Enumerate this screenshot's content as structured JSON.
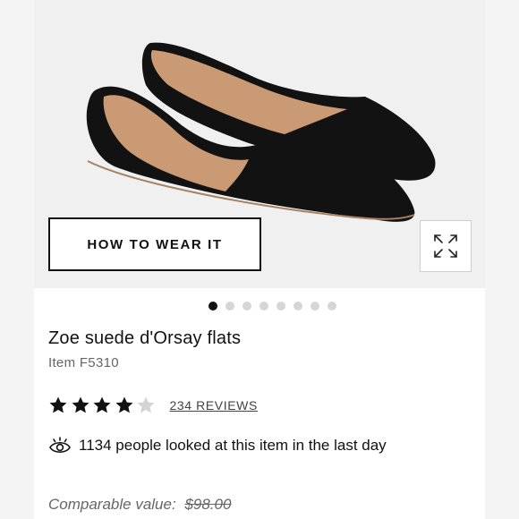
{
  "product": {
    "how_to_wear_label": "HOW TO WEAR IT",
    "carousel": {
      "total": 8,
      "active_index": 0
    },
    "title": "Zoe suede d'Orsay flats",
    "item_number": "Item F5310",
    "rating": {
      "stars": 4,
      "max": 5,
      "reviews_label": "234 REVIEWS"
    },
    "views_text": "1134 people looked at this item in the last day",
    "comparable_label": "Comparable value:",
    "comparable_price": "$98.00"
  },
  "colors": {
    "shoe": "#121212",
    "lining": "#c99a73",
    "star_filled": "#111111",
    "star_empty": "#d4d4d4"
  }
}
